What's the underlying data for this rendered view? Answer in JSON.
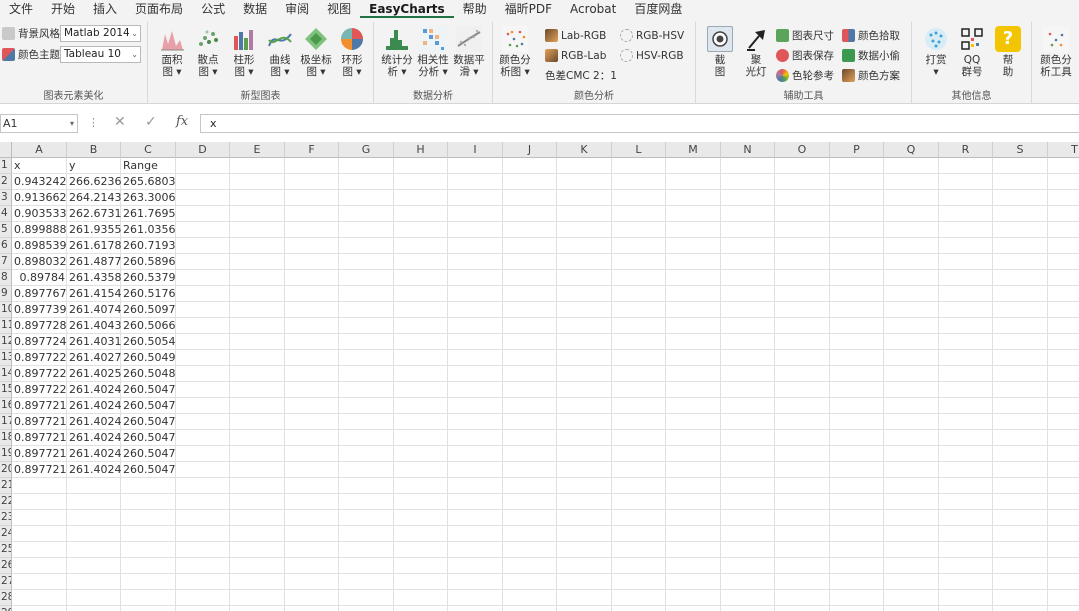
{
  "menu": [
    "文件",
    "开始",
    "插入",
    "页面布局",
    "公式",
    "数据",
    "审阅",
    "视图",
    "EasyCharts",
    "帮助",
    "福昕PDF",
    "Acrobat",
    "百度网盘"
  ],
  "ribbon": {
    "style_group": {
      "bg_style_label": "背景风格",
      "color_theme_label": "颜色主题",
      "bg_style_value": "Matlab 2014",
      "color_theme_value": "Tableau 10",
      "group_label": "图表元素美化"
    },
    "new_charts": {
      "buttons": [
        {
          "l1": "面积",
          "l2": "图 ▾"
        },
        {
          "l1": "散点",
          "l2": "图 ▾"
        },
        {
          "l1": "柱形",
          "l2": "图 ▾"
        },
        {
          "l1": "曲线",
          "l2": "图 ▾"
        },
        {
          "l1": "极坐标",
          "l2": "图 ▾"
        },
        {
          "l1": "环形",
          "l2": "图 ▾"
        }
      ],
      "group_label": "新型图表"
    },
    "data_analysis": {
      "buttons": [
        {
          "l1": "统计分",
          "l2": "析 ▾"
        },
        {
          "l1": "相关性",
          "l2": "分析 ▾"
        },
        {
          "l1": "数据平",
          "l2": "滑 ▾"
        }
      ],
      "group_label": "数据分析"
    },
    "color_analysis": {
      "main_button": {
        "l1": "颜色分",
        "l2": "析图 ▾"
      },
      "lab_rgb": "Lab-RGB",
      "rgb_lab": "RGB-Lab",
      "rgb_hsv": "RGB-HSV",
      "hsv_rgb": "HSV-RGB",
      "cmc": "色差CMC 2：1",
      "group_label": "颜色分析"
    },
    "aux_tools": {
      "screenshot": {
        "l1": "截",
        "l2": "图"
      },
      "spotlight": {
        "l1": "聚",
        "l2": "光灯"
      },
      "chart_size": "图表尺寸",
      "chart_save": "图表保存",
      "color_wheel": "色轮参考",
      "color_pick": "颜色拾取",
      "data_thief": "数据小偷",
      "color_scheme": "颜色方案",
      "group_label": "辅助工具"
    },
    "other_info": {
      "reward": {
        "l1": "打赏",
        "l2": "▾"
      },
      "qq": {
        "l1": "QQ",
        "l2": "群号"
      },
      "help": {
        "l1": "帮",
        "l2": "助"
      },
      "group_label": "其他信息"
    },
    "color_tools": {
      "l1": "颜色分",
      "l2": "析工具"
    }
  },
  "formula_bar": {
    "name_box": "A1",
    "fx": "fx",
    "content": "x"
  },
  "grid": {
    "columns": [
      "A",
      "B",
      "C",
      "D",
      "E",
      "F",
      "G",
      "H",
      "I",
      "J",
      "K",
      "L",
      "M",
      "N",
      "O",
      "P",
      "Q",
      "R",
      "S",
      "T"
    ],
    "row_numbers": [
      "1",
      "2",
      "3",
      "4",
      "5",
      "6",
      "7",
      "8",
      "9",
      "10",
      "11",
      "12",
      "13",
      "14",
      "15",
      "16",
      "17",
      "18",
      "19",
      "20",
      "21",
      "22",
      "23",
      "24",
      "25",
      "26",
      "27",
      "28",
      "29"
    ],
    "headers": [
      "x",
      "y",
      "Range"
    ],
    "rows": [
      [
        "0.943242",
        "266.6236",
        "265.6803"
      ],
      [
        "0.913662",
        "264.2143",
        "263.3006"
      ],
      [
        "0.903533",
        "262.6731",
        "261.7695"
      ],
      [
        "0.899888",
        "261.9355",
        "261.0356"
      ],
      [
        "0.898539",
        "261.6178",
        "260.7193"
      ],
      [
        "0.898032",
        "261.4877",
        "260.5896"
      ],
      [
        "0.89784",
        "261.4358",
        "260.5379"
      ],
      [
        "0.897767",
        "261.4154",
        "260.5176"
      ],
      [
        "0.897739",
        "261.4074",
        "260.5097"
      ],
      [
        "0.897728",
        "261.4043",
        "260.5066"
      ],
      [
        "0.897724",
        "261.4031",
        "260.5054"
      ],
      [
        "0.897722",
        "261.4027",
        "260.5049"
      ],
      [
        "0.897722",
        "261.4025",
        "260.5048"
      ],
      [
        "0.897722",
        "261.4024",
        "260.5047"
      ],
      [
        "0.897721",
        "261.4024",
        "260.5047"
      ],
      [
        "0.897721",
        "261.4024",
        "260.5047"
      ],
      [
        "0.897721",
        "261.4024",
        "260.5047"
      ],
      [
        "0.897721",
        "261.4024",
        "260.5047"
      ],
      [
        "0.897721",
        "261.4024",
        "260.5047"
      ]
    ]
  },
  "colors": {
    "accent": "#217346",
    "help_icon": "#f2c500"
  }
}
